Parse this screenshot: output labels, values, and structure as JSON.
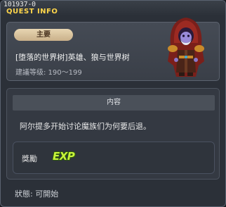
{
  "window": {
    "quest_id": "101937-0",
    "title": "QUEST INFO"
  },
  "header": {
    "badge": "主要",
    "quest_name": "[堕落的世界树]英雄、狼与世界树",
    "level": "建議等级: 190〜199",
    "npc_icon": "hooded-mage-npc"
  },
  "content": {
    "section_title": "内容",
    "description": "阿尔提多开始讨论魔族们为何要后退。",
    "reward": {
      "label": "獎勵",
      "icon": "exp-icon",
      "icon_text": "EXP"
    }
  },
  "footer": {
    "status": "狀態:  可開始"
  },
  "colors": {
    "title_accent": "#ffd64a",
    "badge_bg": "#d8c29c",
    "exp_green": "#c8f43c"
  }
}
